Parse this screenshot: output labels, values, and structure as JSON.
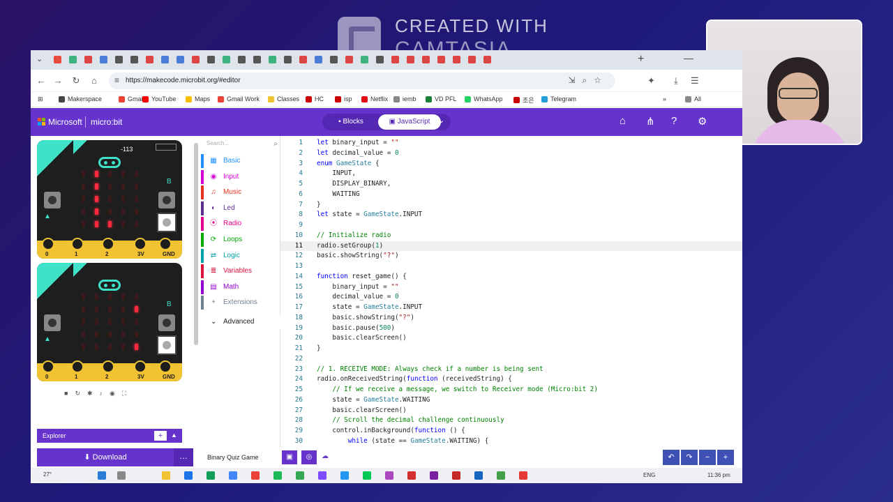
{
  "watermark": {
    "line1": "CREATED WITH",
    "line2": "CAMTASIA"
  },
  "browser": {
    "url": "https://makecode.microbit.org/#editor",
    "tab_colors": [
      "#e74c3c",
      "#3fb37f",
      "#d44",
      "#4a7cd8",
      "#555",
      "#555",
      "#d44",
      "#4a7cd8",
      "#4a7cd8",
      "#d44",
      "#555",
      "#3fb37f",
      "#555",
      "#555",
      "#3fb37f",
      "#555",
      "#d44",
      "#4a7cd8",
      "#555",
      "#d44",
      "#3fb37f",
      "#555",
      "#d44",
      "#d44",
      "#d44",
      "#d44",
      "#d44",
      "#d44",
      "#d44"
    ],
    "bookmarks": [
      {
        "label": "Makerspace",
        "color": "#444"
      },
      {
        "label": "Gmail",
        "color": "#ea4335"
      },
      {
        "label": "YouTube",
        "color": "#ff0000"
      },
      {
        "label": "Maps",
        "color": "#fbbc05"
      },
      {
        "label": "Gmail Work",
        "color": "#ea4335"
      },
      {
        "label": "Classes",
        "color": "#f1c232"
      },
      {
        "label": "HC",
        "color": "#c00"
      },
      {
        "label": "isp",
        "color": "#c00"
      },
      {
        "label": "Netflix",
        "color": "#e50914"
      },
      {
        "label": "iemb",
        "color": "#888"
      },
      {
        "label": "VD PFL",
        "color": "#1a7f37"
      },
      {
        "label": "WhatsApp",
        "color": "#25d366"
      },
      {
        "label": "조은",
        "color": "#c00"
      },
      {
        "label": "Telegram",
        "color": "#229ed9"
      }
    ],
    "bookmarks_more": "»",
    "all_bookmarks": "All"
  },
  "makecode": {
    "brand": "Microsoft",
    "product": "micro:bit",
    "blocks_label": "Blocks",
    "js_label": "JavaScript",
    "search_placeholder": "Search...",
    "categories": [
      {
        "label": "Basic",
        "color": "#1e90ff",
        "icon": "grid-icon"
      },
      {
        "label": "Input",
        "color": "#d400d4",
        "icon": "pointer-icon"
      },
      {
        "label": "Music",
        "color": "#e63022",
        "icon": "headphones-icon"
      },
      {
        "label": "Led",
        "color": "#5c2d91",
        "icon": "toggle-icon"
      },
      {
        "label": "Radio",
        "color": "#e3008c",
        "icon": "signal-icon"
      },
      {
        "label": "Loops",
        "color": "#00aa00",
        "icon": "refresh-icon"
      },
      {
        "label": "Logic",
        "color": "#00a4a6",
        "icon": "shuffle-icon"
      },
      {
        "label": "Variables",
        "color": "#dc143c",
        "icon": "list-icon"
      },
      {
        "label": "Math",
        "color": "#9400d3",
        "icon": "calculator-icon"
      },
      {
        "label": "Extensions",
        "color": "#708090",
        "icon": "plus-icon"
      }
    ],
    "advanced_label": "Advanced",
    "explorer_label": "Explorer",
    "download_label": "Download",
    "project_name": "Binary Quiz Game"
  },
  "simulator": {
    "signal": "-113",
    "pins": [
      "0",
      "1",
      "2",
      "3V",
      "GND"
    ],
    "board1_leds": [
      [
        0,
        1
      ],
      [
        1,
        1
      ],
      [
        2,
        1
      ],
      [
        3,
        1
      ],
      [
        4,
        1
      ],
      [
        4,
        2
      ]
    ],
    "board2_leds": [
      [
        1,
        4
      ],
      [
        4,
        4
      ]
    ]
  },
  "code": {
    "current_line": 11,
    "lines": [
      "let binary_input = \"\"",
      "let decimal_value = 0",
      "enum GameState {",
      "    INPUT,",
      "    DISPLAY_BINARY,",
      "    WAITING",
      "}",
      "let state = GameState.INPUT",
      "",
      "// Initialize radio",
      "radio.setGroup(1)",
      "basic.showString(\"?\")",
      "",
      "function reset_game() {",
      "    binary_input = \"\"",
      "    decimal_value = 0",
      "    state = GameState.INPUT",
      "    basic.showString(\"?\")",
      "    basic.pause(500)",
      "    basic.clearScreen()",
      "}",
      "",
      "// 1. RECEIVE MODE: Always check if a number is being sent",
      "radio.onReceivedString(function (receivedString) {",
      "    // If we receive a message, we switch to Receiver mode (Micro:bit 2)",
      "    state = GameState.WAITING",
      "    basic.clearScreen()",
      "    // Scroll the decimal challenge continuously",
      "    control.inBackground(function () {",
      "        while (state == GameState.WAITING) {"
    ]
  },
  "taskbar": {
    "weather": "27°",
    "lang": "ENG",
    "time": "11:36 pm"
  }
}
